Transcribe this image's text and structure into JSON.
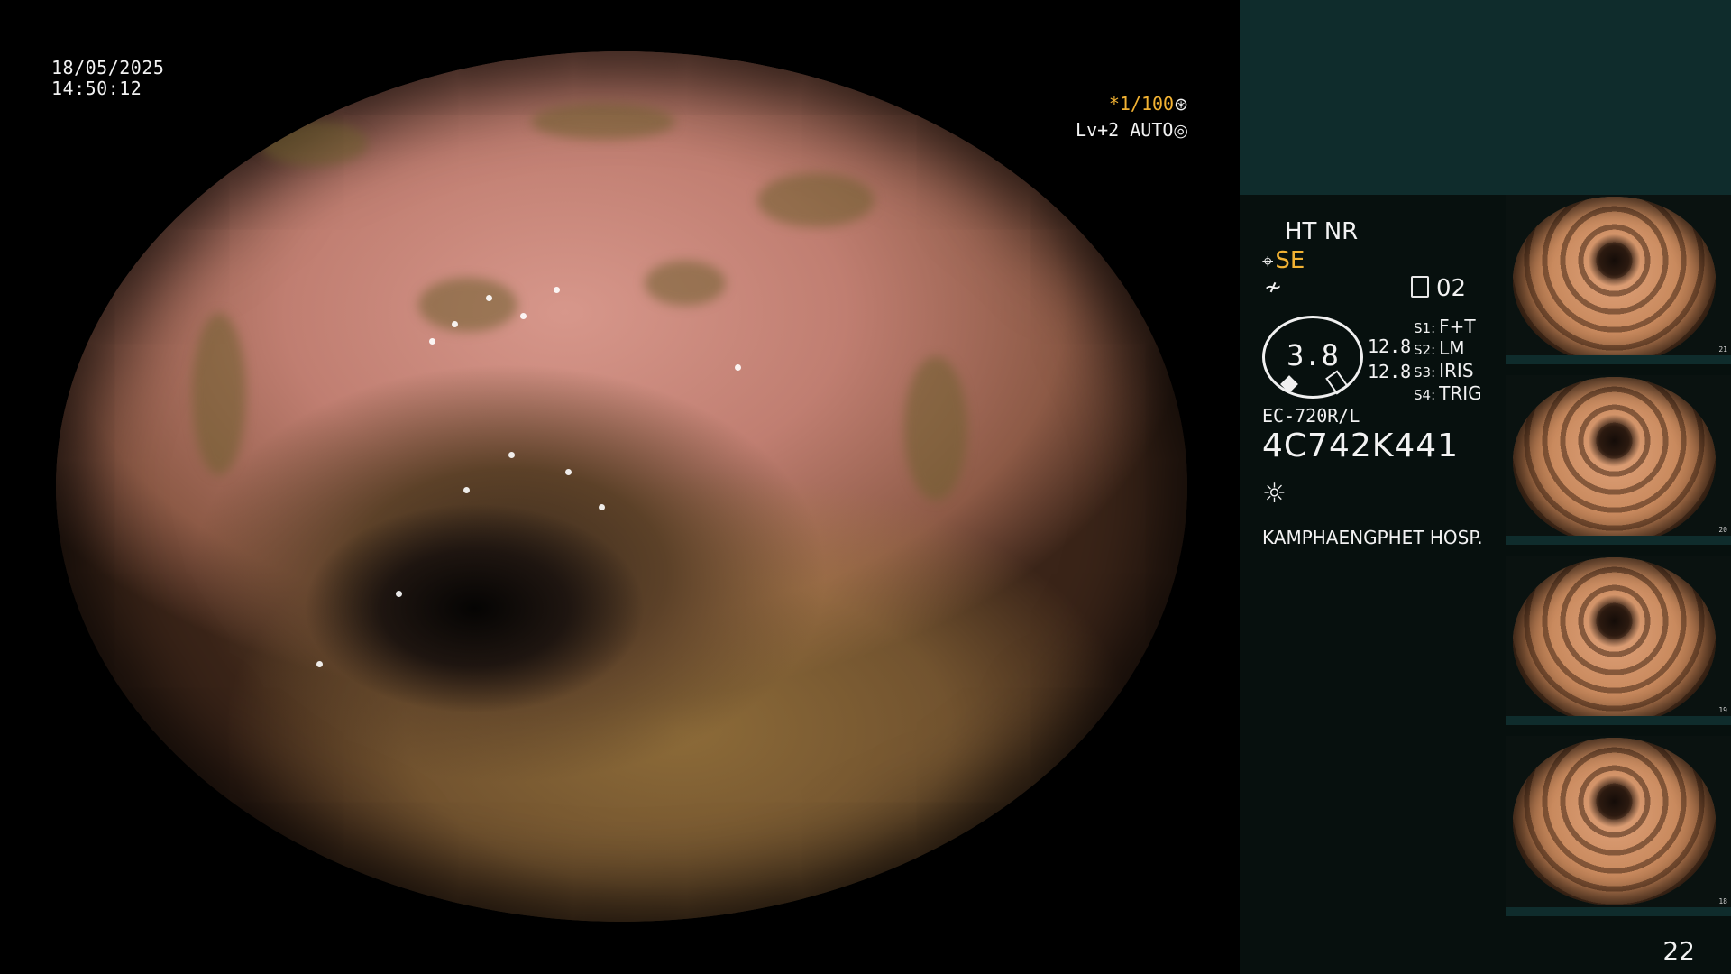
{
  "overlay": {
    "date": "18/05/2025",
    "time": "14:50:12",
    "exposure": "*1/100",
    "brightness": "Lv+2 AUTO"
  },
  "panel": {
    "mode_ht": "HT NR",
    "mode_se": "SE",
    "memory_number": "02",
    "zoom_value": "3.8",
    "level_1": "12.8",
    "level_2": "12.8",
    "switches": [
      {
        "key": "S1:",
        "value": "F+T"
      },
      {
        "key": "S2:",
        "value": "LM"
      },
      {
        "key": "S3:",
        "value": "IRIS"
      },
      {
        "key": "S4:",
        "value": "TRIG"
      }
    ],
    "scope_model": "EC-720R/L",
    "scope_serial": "4C742K441",
    "hospital": "KAMPHAENGPHET HOSP."
  },
  "thumbnails": [
    {
      "index": "21"
    },
    {
      "index": "20"
    },
    {
      "index": "19"
    },
    {
      "index": "18"
    }
  ],
  "page_number": "22",
  "icons": {
    "exposure": "shutter-icon",
    "brightness": "iris-icon",
    "structure": "scope-icon",
    "filter": "filter-icon",
    "memory": "memory-card-icon",
    "light": "light-source-icon"
  },
  "colors": {
    "panel_top": "#0f2c2c",
    "panel": "#07100e",
    "accent": "#f2b233"
  }
}
